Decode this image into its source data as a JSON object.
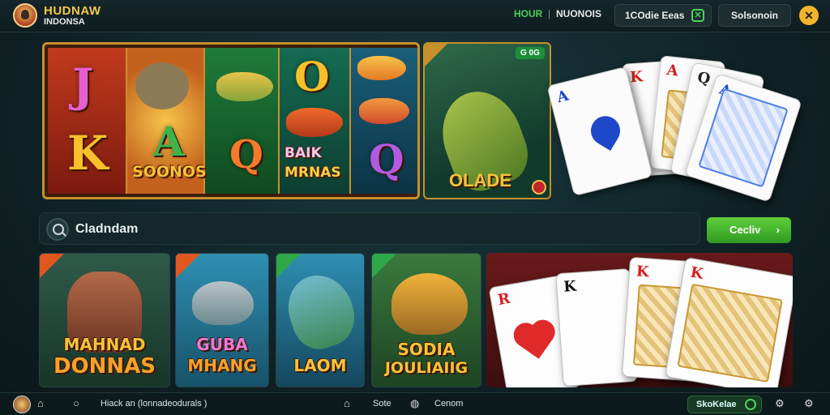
{
  "header": {
    "brand_title": "HUDNAW",
    "brand_subtitle": "INDONSA",
    "nav_active": "HOUR",
    "nav_second": "NUONOIS",
    "pill_left": "1COdie Eeas",
    "pill_right": "Solsonoin",
    "close_glyph": "✕"
  },
  "banner": {
    "sym_j": "J",
    "sym_k": "K",
    "sym_a": "A",
    "sym_o": "O",
    "sym_q": "Q",
    "sym_q2": "Q",
    "caption_1": "SOONOS",
    "caption_2": "BAIK",
    "caption_3": "MRNAS"
  },
  "fish_banner": {
    "badge": "G 0G",
    "caption": "OLADE"
  },
  "top_cards": {
    "c1": "A",
    "c2": "K",
    "c3": "A",
    "c4": "Q",
    "c5": "A"
  },
  "search": {
    "text": "Cladndam",
    "button_label": "Cecliv",
    "chevron": "›"
  },
  "tiles": [
    {
      "title_1": "MAHNAD",
      "title_2": "DONNAS"
    },
    {
      "title_1": "GUBA",
      "title_2": "MHANG"
    },
    {
      "title_1": "LAOM"
    },
    {
      "title_1": "SODIA",
      "title_2": "JOULIAIIG"
    }
  ],
  "bottom_cards": {
    "b1": "R",
    "b2": "K",
    "b3": "K",
    "b4": "K"
  },
  "bottom_bar": {
    "text_main": "Hiack an (lonnadeodurals )",
    "text_mid_1": "Sote",
    "text_mid_2": "Cenom",
    "pill": "SkoKelae",
    "home_glyph": "⌂",
    "circle_glyph": "○",
    "house_glyph": "⌂",
    "globe_glyph": "◍",
    "settings_glyph": "⚙",
    "gear_glyph": "⚙"
  },
  "colors": {
    "accent_green": "#4fd15a",
    "gold": "#c7902b",
    "brand_yellow": "#f2c84b"
  }
}
